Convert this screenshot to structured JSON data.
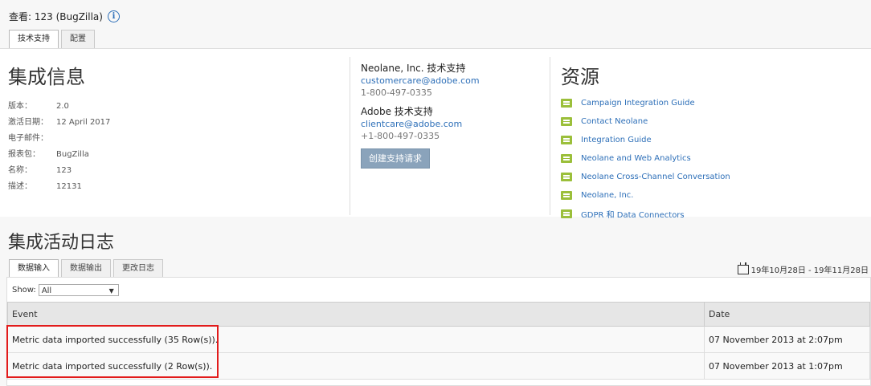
{
  "header": {
    "title": "查看: 123 (BugZilla)",
    "info_icon": "info-icon"
  },
  "top_tabs": [
    {
      "label": "技术支持",
      "active": true
    },
    {
      "label": "配置",
      "active": false
    }
  ],
  "integration_info": {
    "title": "集成信息",
    "fields": [
      {
        "key": "版本：",
        "value": "2.0"
      },
      {
        "key": "激活日期：",
        "value": "12 April 2017"
      },
      {
        "key": "电子邮件：",
        "value": ""
      },
      {
        "key": "报表包：",
        "value": "BugZilla"
      },
      {
        "key": "名称：",
        "value": "123"
      },
      {
        "key": "描述：",
        "value": "12131"
      }
    ]
  },
  "support": {
    "neolane_title": "Neolane, Inc. 技术支持",
    "neolane_email": "customercare@adobe.com",
    "neolane_phone": "1-800-497-0335",
    "adobe_title": "Adobe 技术支持",
    "adobe_email": "clientcare@adobe.com",
    "adobe_phone": "+1-800-497-0335",
    "button_label": "创建支持请求"
  },
  "resources": {
    "title": "资源",
    "items": [
      "Campaign Integration Guide",
      "Contact Neolane",
      "Integration Guide",
      "Neolane and Web Analytics",
      "Neolane Cross-Channel Conversation",
      "Neolane, Inc.",
      "GDPR 和 Data Connectors"
    ]
  },
  "activity": {
    "title": "集成活动日志",
    "tabs": [
      {
        "label": "数据输入",
        "active": true
      },
      {
        "label": "数据输出",
        "active": false
      },
      {
        "label": "更改日志",
        "active": false
      }
    ],
    "date_range": "19年10月28日 - 19年11月28日",
    "show_label": "Show:",
    "show_value": "All",
    "columns": [
      "Event",
      "Date"
    ],
    "rows": [
      {
        "event": "Metric data imported successfully (35 Row(s)).",
        "date": "07 November 2013 at 2:07pm"
      },
      {
        "event": "Metric data imported successfully (2 Row(s)).",
        "date": "07 November 2013 at 1:07pm"
      }
    ]
  },
  "colors": {
    "link": "#2d6fb8",
    "highlight": "#e21b1b",
    "doc_icon": "#9bbf3a"
  }
}
